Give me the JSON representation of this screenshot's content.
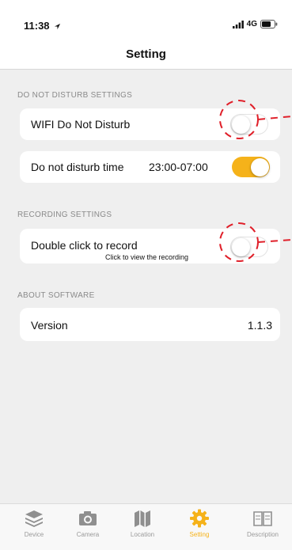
{
  "status_bar": {
    "time": "11:38",
    "network": "4G"
  },
  "nav": {
    "title": "Setting"
  },
  "sections": {
    "dnd": {
      "header": "DO NOT DISTURB SETTINGS",
      "wifi_label": "WIFI Do Not Disturb",
      "wifi_enabled": false,
      "time_label": "Do not disturb time",
      "time_value": "23:00-07:00",
      "time_enabled": true
    },
    "recording": {
      "header": "RECORDING SETTINGS",
      "double_click_label": "Double click to record",
      "double_click_hint": "Click to view the recording",
      "double_click_enabled": false
    },
    "about": {
      "header": "ABOUT SOFTWARE",
      "version_label": "Version",
      "version_value": "1.1.3"
    }
  },
  "tabs": [
    {
      "label": "Device",
      "icon": "layers-icon",
      "active": false
    },
    {
      "label": "Camera",
      "icon": "camera-icon",
      "active": false
    },
    {
      "label": "Location",
      "icon": "map-icon",
      "active": false
    },
    {
      "label": "Setting",
      "icon": "gear-icon",
      "active": true
    },
    {
      "label": "Description",
      "icon": "book-icon",
      "active": false
    }
  ],
  "colors": {
    "accent": "#f5b21a",
    "annotation": "#e0202a",
    "tab_inactive": "#9a9a9a"
  }
}
